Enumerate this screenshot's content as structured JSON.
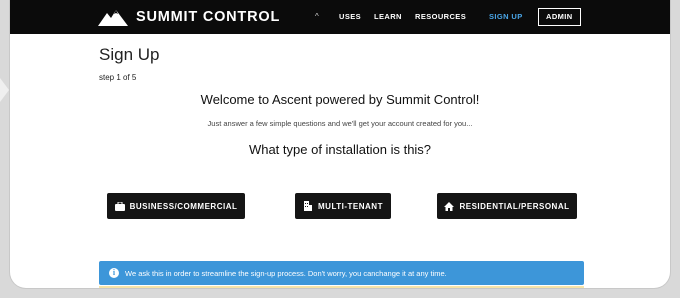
{
  "brand": {
    "name": "SUMMIT CONTROL",
    "logo_icon": "mountain-icon"
  },
  "nav": {
    "caret_glyph": "^",
    "links": [
      {
        "label": "USES"
      },
      {
        "label": "LEARN"
      },
      {
        "label": "RESOURCES"
      },
      {
        "label": "SIGN UP",
        "accent": true
      },
      {
        "label": "ADMIN",
        "boxed": true
      }
    ],
    "accent_color": "#4aa6e8"
  },
  "page": {
    "title": "Sign Up",
    "step": "step 1 of 5",
    "welcome": "Welcome to Ascent powered by Summit Control!",
    "intro": "Just answer a few simple questions and we'll get your account created for you...",
    "question": "What type of installation is this?"
  },
  "options": [
    {
      "label": "BUSINESS/COMMERCIAL",
      "icon": "briefcase-icon"
    },
    {
      "label": "MULTI-TENANT",
      "icon": "building-icon"
    },
    {
      "label": "RESIDENTIAL/PERSONAL",
      "icon": "home-icon"
    }
  ],
  "info": {
    "icon": "info-icon",
    "text": "We ask this in order to streamline the sign-up process. Don't worry, you canchange it at any time.",
    "color": "#3d96d9"
  }
}
